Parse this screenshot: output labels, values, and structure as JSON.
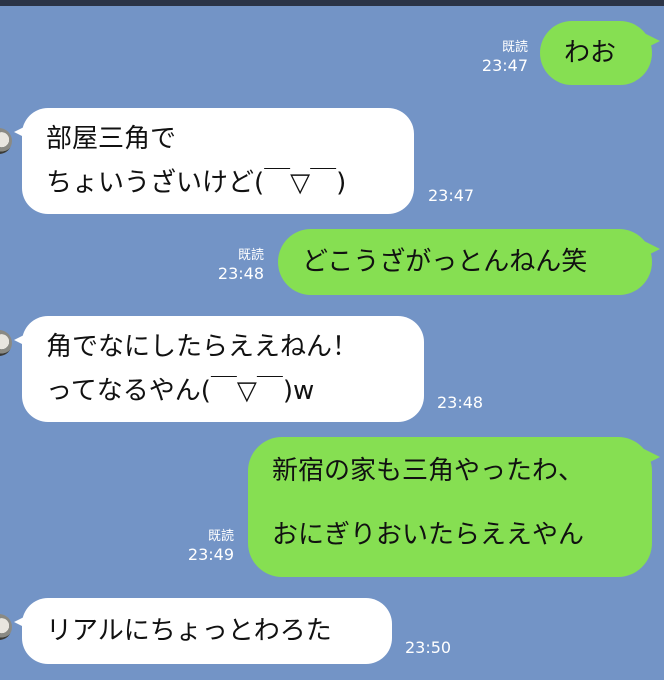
{
  "chat": {
    "read_label": "既読",
    "messages": [
      {
        "direction": "out",
        "lines": [
          "わお"
        ],
        "time": "23:47",
        "read": "既読"
      },
      {
        "direction": "in",
        "lines": [
          "部屋三角で",
          "ちょいうざいけど(￣▽￣)"
        ],
        "time": "23:47"
      },
      {
        "direction": "out",
        "lines": [
          "どこうざがっとんねん笑"
        ],
        "time": "23:48",
        "read": "既読"
      },
      {
        "direction": "in",
        "lines": [
          "角でなにしたらええねん！",
          "ってなるやん(￣▽￣)w"
        ],
        "time": "23:48"
      },
      {
        "direction": "out",
        "lines": [
          "新宿の家も三角やったわ、",
          "",
          "おにぎりおいたらええやん"
        ],
        "time": "23:49",
        "read": "既読"
      },
      {
        "direction": "in",
        "lines": [
          "リアルにちょっとわろた"
        ],
        "time": "23:50"
      }
    ]
  },
  "colors": {
    "background": "#7394c6",
    "outgoing_bubble": "#86df52",
    "incoming_bubble": "#ffffff"
  }
}
